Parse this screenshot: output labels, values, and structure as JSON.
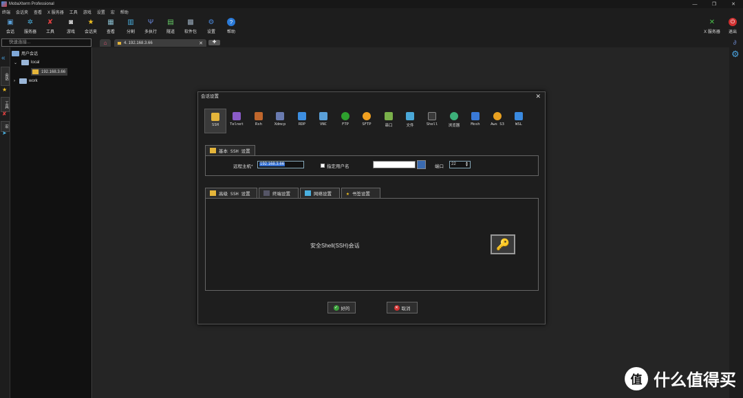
{
  "window": {
    "title": "MobaXterm Professional",
    "minimize": "—",
    "maximize": "❐",
    "close": "✕"
  },
  "menu": [
    "终端",
    "会话夹",
    "查看",
    "X 服务器",
    "工具",
    "游戏",
    "设置",
    "宏",
    "帮助"
  ],
  "toolbar": [
    {
      "label": "会话",
      "icon": "session-icon"
    },
    {
      "label": "服务器",
      "icon": "servers-icon"
    },
    {
      "label": "工具",
      "icon": "tools-icon"
    },
    {
      "label": "游戏",
      "icon": "games-icon"
    },
    {
      "label": "会话夹",
      "icon": "sessions-star-icon"
    },
    {
      "label": "查看",
      "icon": "view-icon"
    },
    {
      "label": "分割",
      "icon": "split-icon"
    },
    {
      "label": "多执行",
      "icon": "multiexec-icon"
    },
    {
      "label": "隧道",
      "icon": "tunnel-icon"
    },
    {
      "label": "软件包",
      "icon": "packages-icon"
    },
    {
      "label": "设置",
      "icon": "settings-icon"
    },
    {
      "label": "帮助",
      "icon": "help-icon"
    }
  ],
  "toolbar_right": {
    "xserver": "X 服务器",
    "exit": "退出"
  },
  "quick_connect_placeholder": "快速连接...",
  "tabs": {
    "session": "4. 192.168.3.66",
    "close": "✕",
    "add": "✚"
  },
  "sidebar": {
    "root": "用户会话",
    "folder1": "local",
    "session": "192.168.3.66",
    "folder2": "work",
    "vtab_sessions": "会话",
    "vtab_tools": "工具",
    "vtab_macros": "宏"
  },
  "dialog": {
    "title": "会话设置",
    "session_types": [
      {
        "label": "SSH",
        "color": "#e5b53a"
      },
      {
        "label": "Telnet",
        "color": "#8a5bc8"
      },
      {
        "label": "Rsh",
        "color": "#c0662c"
      },
      {
        "label": "Xdmcp",
        "color": "#6a7bb0"
      },
      {
        "label": "RDP",
        "color": "#3d8ee0"
      },
      {
        "label": "VNC",
        "color": "#5aa0d8"
      },
      {
        "label": "FTP",
        "color": "#2ea02e"
      },
      {
        "label": "SFTP",
        "color": "#f0a020"
      },
      {
        "label": "串口",
        "color": "#7ab04a"
      },
      {
        "label": "文件",
        "color": "#4aa8d8"
      },
      {
        "label": "Shell",
        "color": "#3a3a3a"
      },
      {
        "label": "浏览器",
        "color": "#3db07a"
      },
      {
        "label": "Mosh",
        "color": "#3a7ad8"
      },
      {
        "label": "Aws S3",
        "color": "#e8a020"
      },
      {
        "label": "WSL",
        "color": "#3a8ae0"
      }
    ],
    "basic_tab": "基本 SSH 设置",
    "remote_host_label": "远程主机*",
    "remote_host_value": "192.168.3.66",
    "specify_user_label": "指定用户名",
    "port_label": "端口",
    "port_value": "22",
    "sub_tabs": [
      "高级 SSH 设置",
      "终端设置",
      "网络设置",
      "书签设置"
    ],
    "description": "安全Shell(SSH)会话",
    "ok": "好的",
    "cancel": "取消"
  },
  "watermark": {
    "logo": "值",
    "text": "什么值得买"
  }
}
